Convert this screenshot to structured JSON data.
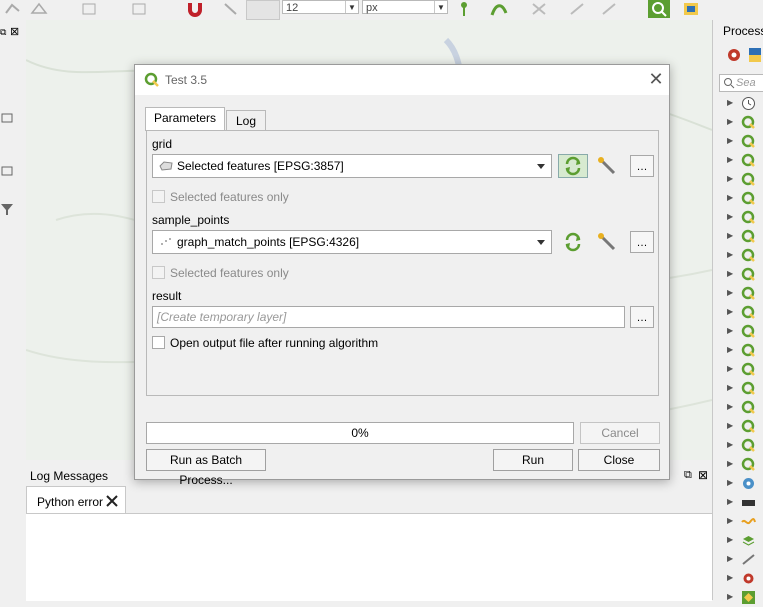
{
  "toolbar": {
    "size_value": "12",
    "unit_value": "px"
  },
  "processing_panel": {
    "title": "Process",
    "search_placeholder": "Sea"
  },
  "log_panel": {
    "title": "Log Messages",
    "tab_label": "Python error"
  },
  "dialog": {
    "title": "Test 3.5",
    "tabs": [
      {
        "label": "Parameters",
        "active": true
      },
      {
        "label": "Log",
        "active": false
      }
    ],
    "params": {
      "grid": {
        "label": "grid",
        "value": "Selected features [EPSG:3857]",
        "selected_only_label": "Selected features only"
      },
      "sample_points": {
        "label": "sample_points",
        "value": "graph_match_points [EPSG:4326]",
        "selected_only_label": "Selected features only"
      },
      "result": {
        "label": "result",
        "placeholder": "[Create temporary layer]"
      },
      "open_output_label": "Open output file after running algorithm"
    },
    "progress_text": "0%",
    "buttons": {
      "cancel": "Cancel",
      "batch": "Run as Batch Process...",
      "run": "Run",
      "close": "Close"
    }
  },
  "colors": {
    "qgis_green": "#5c9e31",
    "dialog_bg": "#f0f0f0",
    "map_bg": "#edf1ec"
  }
}
